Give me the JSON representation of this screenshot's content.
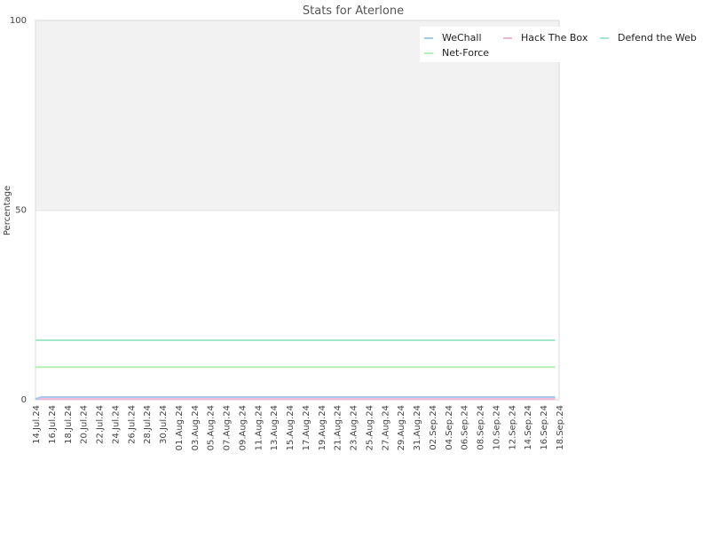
{
  "chart_data": {
    "type": "line",
    "title": "Stats for Aterlone",
    "xlabel": "",
    "ylabel": "Percentage",
    "ylim": [
      0,
      100
    ],
    "yticks": [
      0,
      50,
      100
    ],
    "grid": "horizontal band shading above 50",
    "legend_position": "top-right",
    "x_start": "2024-07-14",
    "x_end": "2024-09-18",
    "xtick_labels": [
      "14.Jul.24",
      "16.Jul.24",
      "18.Jul.24",
      "20.Jul.24",
      "22.Jul.24",
      "24.Jul.24",
      "26.Jul.24",
      "28.Jul.24",
      "30.Jul.24",
      "01.Aug.24",
      "03.Aug.24",
      "05.Aug.24",
      "07.Aug.24",
      "09.Aug.24",
      "11.Aug.24",
      "13.Aug.24",
      "15.Aug.24",
      "17.Aug.24",
      "19.Aug.24",
      "21.Aug.24",
      "23.Aug.24",
      "25.Aug.24",
      "27.Aug.24",
      "29.Aug.24",
      "31.Aug.24",
      "02.Sep.24",
      "04.Sep.24",
      "06.Sep.24",
      "08.Sep.24",
      "10.Sep.24",
      "12.Sep.24",
      "14.Sep.24",
      "16.Sep.24",
      "18.Sep.24"
    ],
    "series": [
      {
        "name": "WeChall",
        "color": "#a4c8f0",
        "points": [
          [
            0,
            0.2
          ],
          [
            0.7,
            0.7
          ],
          [
            65.5,
            0.7
          ]
        ]
      },
      {
        "name": "Hack The Box",
        "color": "#f0b4d2",
        "points": [
          [
            0,
            0.2
          ],
          [
            65.5,
            0.2
          ]
        ]
      },
      {
        "name": "Defend the Web",
        "color": "#a0e8c8",
        "points": [
          [
            0,
            15.7
          ],
          [
            65.5,
            15.7
          ]
        ]
      },
      {
        "name": "Net-Force",
        "color": "#b4f0b4",
        "points": [
          [
            0,
            8.6
          ],
          [
            65.5,
            8.6
          ]
        ]
      }
    ]
  }
}
